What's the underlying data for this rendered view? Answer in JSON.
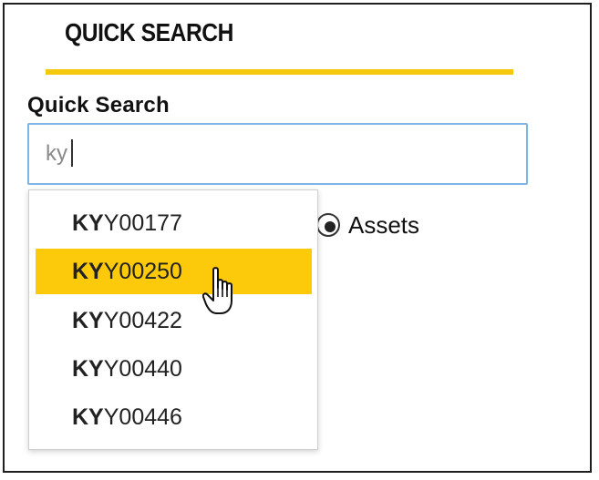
{
  "panel": {
    "title": "QUICK SEARCH"
  },
  "search": {
    "label": "Quick Search",
    "value": "ky"
  },
  "radio": {
    "assets_label": "Assets",
    "assets_selected": true
  },
  "dropdown": {
    "items": [
      {
        "match": "KY",
        "rest": "Y00177",
        "selected": false
      },
      {
        "match": "KY",
        "rest": "Y00250",
        "selected": true
      },
      {
        "match": "KY",
        "rest": "Y00422",
        "selected": false
      },
      {
        "match": "KY",
        "rest": "Y00440",
        "selected": false
      },
      {
        "match": "KY",
        "rest": "Y00446",
        "selected": false
      }
    ]
  },
  "colors": {
    "accent": "#f5c80c",
    "highlight": "#fcca0b",
    "input_focus_border": "#7fb4e6"
  },
  "icons": {
    "cursor": "hand-pointer-icon"
  }
}
